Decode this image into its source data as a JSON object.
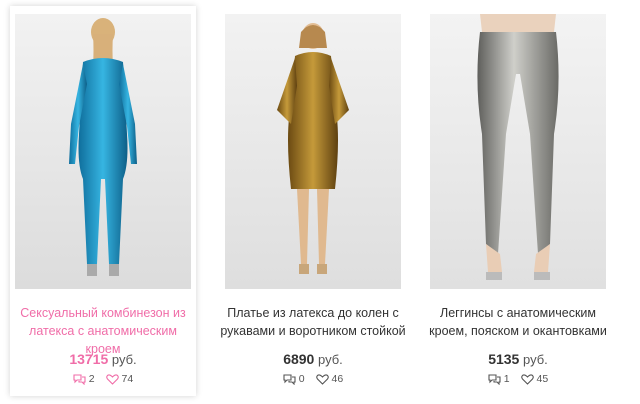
{
  "products": [
    {
      "title_line1": "Сексуальный комбинезон из",
      "title_line2": "латекса с анатомическим кроем",
      "price": "13715",
      "currency": "руб.",
      "comments": "2",
      "likes": "74",
      "image": "blue-latex-catsuit-back-view",
      "active": true
    },
    {
      "title_line1": "Платье из латекса до колен с",
      "title_line2": "рукавами и воротником стойкой",
      "price": "6890",
      "currency": "руб.",
      "comments": "0",
      "likes": "46",
      "image": "gold-latex-knee-dress",
      "active": false
    },
    {
      "title_line1": "Леггинсы с анатомическим",
      "title_line2": "кроем, пояском и окантовками",
      "price": "5135",
      "currency": "руб.",
      "comments": "1",
      "likes": "45",
      "image": "silver-latex-leggings",
      "active": false
    }
  ],
  "colors": {
    "accent": "#f06da8",
    "text": "#333333"
  }
}
